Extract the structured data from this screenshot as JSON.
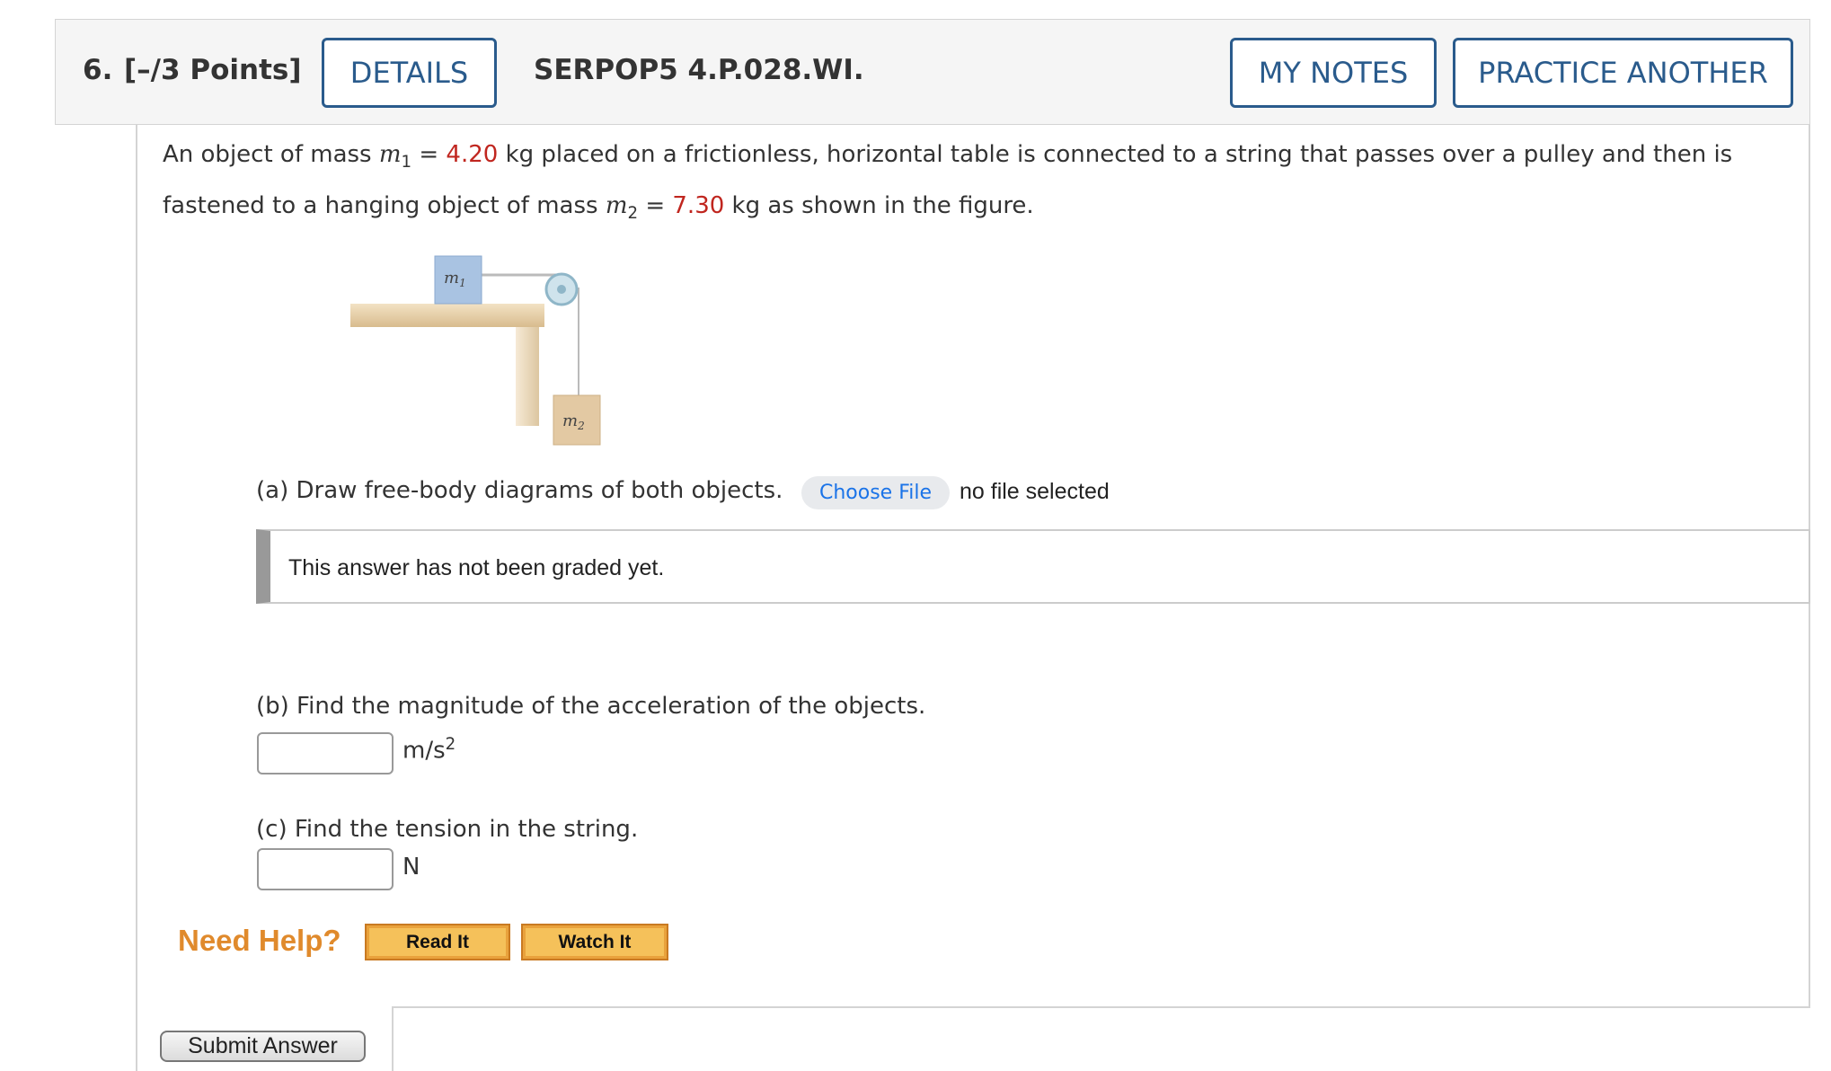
{
  "header": {
    "question_number": "6.",
    "points": "[–/3 Points]",
    "details_label": "DETAILS",
    "problem_id": "SERPOP5 4.P.028.WI.",
    "my_notes_label": "MY NOTES",
    "practice_another_label": "PRACTICE ANOTHER",
    "accent_color": "#2a5b8c"
  },
  "problem": {
    "text_1": "An object of mass ",
    "m1_symbol": "m",
    "m1_sub": "1",
    "eq_1": " = ",
    "m1_value": "4.20",
    "text_2": " kg placed on a frictionless, horizontal table is connected to a string that passes over a pulley and then is fastened to a hanging object of mass ",
    "m2_symbol": "m",
    "m2_sub": "2",
    "eq_2": " = ",
    "m2_value": "7.30",
    "text_3": " kg as shown in the figure.",
    "value_color": "#c0261f"
  },
  "figure": {
    "label_m1": "m1",
    "label_m2": "m2"
  },
  "part_a": {
    "prompt": "(a) Draw free-body diagrams of both objects.",
    "choose_file_label": "Choose File",
    "file_status": "no file selected",
    "grade_message": "This answer has not been graded yet."
  },
  "part_b": {
    "prompt": "(b) Find the magnitude of the acceleration of the objects.",
    "value": "",
    "unit": "m/s",
    "unit_sup": "2"
  },
  "part_c": {
    "prompt": "(c) Find the tension in the string.",
    "value": "",
    "unit": "N"
  },
  "help": {
    "label": "Need Help?",
    "read_it": "Read It",
    "watch_it": "Watch It"
  },
  "submit_label": "Submit Answer"
}
